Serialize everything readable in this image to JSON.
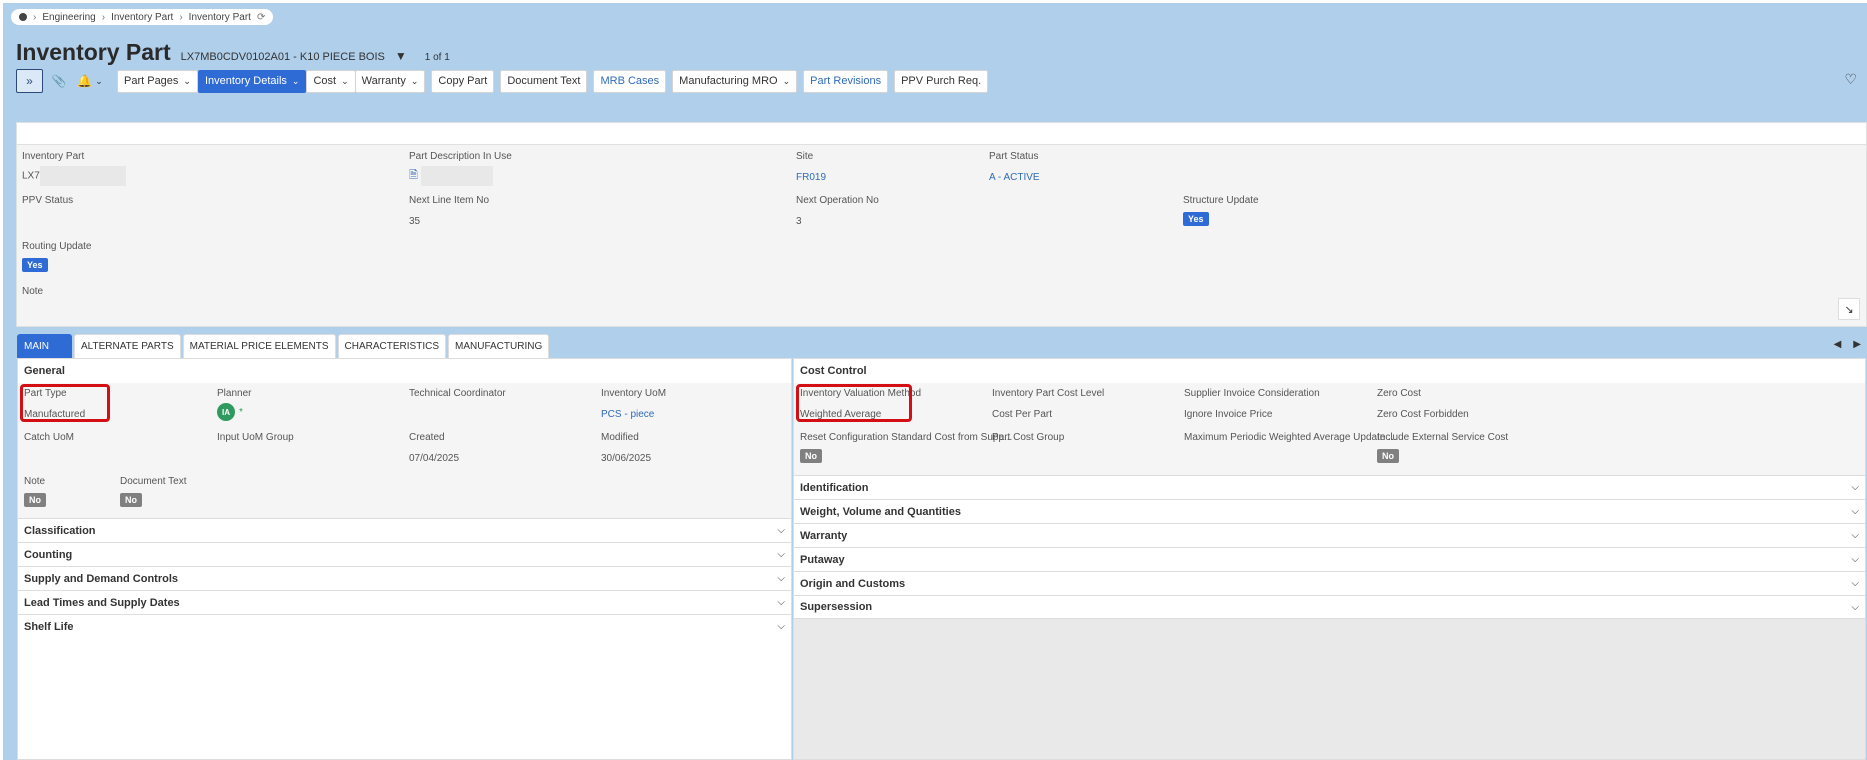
{
  "breadcrumb": {
    "items": [
      "Engineering",
      "Inventory Part",
      "Inventory Part"
    ]
  },
  "header": {
    "page_title": "Inventory Part",
    "record_title": "LX7MB0CDV0102A01 - K10 PIECE BOIS",
    "record_count": "1 of 1"
  },
  "toolbar": {
    "buttons": [
      {
        "label": "Part Pages",
        "has_dropdown": true
      },
      {
        "label": "Inventory Details",
        "has_dropdown": true,
        "active": true
      },
      {
        "label": "Cost",
        "has_dropdown": true
      },
      {
        "label": "Warranty",
        "has_dropdown": true
      },
      {
        "label": "Copy Part"
      },
      {
        "label": "Document Text"
      },
      {
        "label": "MRB Cases",
        "link": true
      },
      {
        "label": "Manufacturing MRO",
        "has_dropdown": true
      },
      {
        "label": "Part Revisions",
        "link": true
      },
      {
        "label": "PPV Purch Req."
      }
    ]
  },
  "header_fields": {
    "inventory_part_label": "Inventory Part",
    "inventory_part_value": "LX7",
    "part_desc_label": "Part Description In Use",
    "site_label": "Site",
    "site_value": "FR019",
    "part_status_label": "Part Status",
    "part_status_value": "A - ACTIVE",
    "ppv_status_label": "PPV Status",
    "next_line_label": "Next Line Item No",
    "next_line_value": "35",
    "next_op_label": "Next Operation No",
    "next_op_value": "3",
    "structure_update_label": "Structure Update",
    "structure_update_value": "Yes",
    "routing_update_label": "Routing Update",
    "routing_update_value": "Yes",
    "note_label": "Note"
  },
  "tabs": [
    "MAIN",
    "ALTERNATE PARTS",
    "MATERIAL PRICE ELEMENTS",
    "CHARACTERISTICS",
    "MANUFACTURING"
  ],
  "general": {
    "title": "General",
    "part_type_label": "Part Type",
    "part_type_value": "Manufactured",
    "planner_label": "Planner",
    "planner_initials": "IA",
    "planner_mark": "*",
    "tech_coord_label": "Technical Coordinator",
    "inv_uom_label": "Inventory UoM",
    "inv_uom_value": "PCS - piece",
    "catch_uom_label": "Catch UoM",
    "input_uom_label": "Input UoM Group",
    "created_label": "Created",
    "created_value": "07/04/2025",
    "modified_label": "Modified",
    "modified_value": "30/06/2025",
    "note_label": "Note",
    "note_value": "No",
    "doc_text_label": "Document Text",
    "doc_text_value": "No"
  },
  "left_accordions": [
    "Classification",
    "Counting",
    "Supply and Demand Controls",
    "Lead Times and Supply Dates",
    "Shelf Life"
  ],
  "cost_control": {
    "title": "Cost Control",
    "valuation_label": "Inventory Valuation Method",
    "valuation_value": "Weighted Average",
    "cost_level_label": "Inventory Part Cost Level",
    "cost_level_value": "Cost Per Part",
    "supplier_inv_label": "Supplier Invoice Consideration",
    "supplier_inv_value": "Ignore Invoice Price",
    "zero_cost_label": "Zero Cost",
    "zero_cost_value": "Zero Cost Forbidden",
    "reset_label": "Reset Configuration Standard Cost from Supp...",
    "reset_value": "No",
    "cost_group_label": "Part Cost Group",
    "max_periodic_label": "Maximum Periodic Weighted Average Update ...",
    "incl_ext_label": "Include External Service Cost",
    "incl_ext_value": "No"
  },
  "right_accordions": [
    "Identification",
    "Weight, Volume and Quantities",
    "Warranty",
    "Putaway",
    "Origin and Customs",
    "Supersession"
  ],
  "colors": {
    "background": "#b0cfeb",
    "primary": "#2f6bd4",
    "highlight": "#d40f14",
    "link": "#2f6bb8"
  }
}
